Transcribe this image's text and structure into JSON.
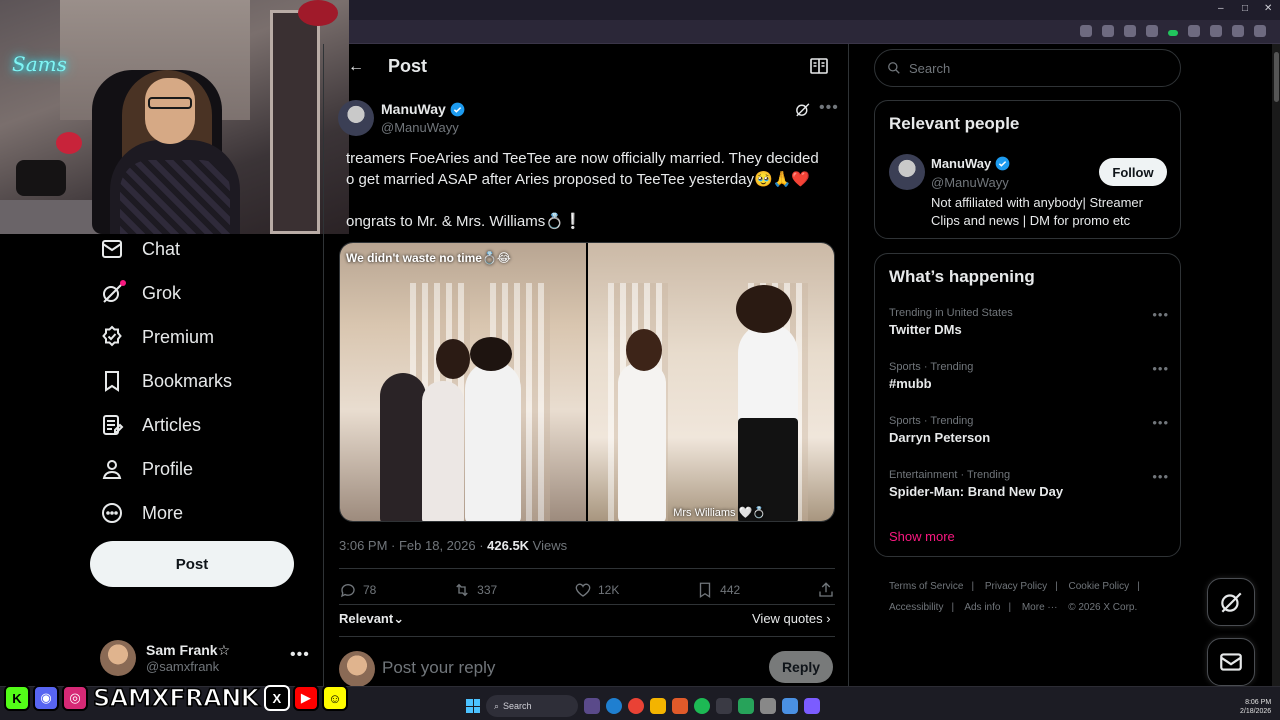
{
  "nav": {
    "chat": "Chat",
    "grok": "Grok",
    "premium": "Premium",
    "bookmarks": "Bookmarks",
    "articles": "Articles",
    "profile": "Profile",
    "more": "More",
    "post_button": "Post"
  },
  "current_user": {
    "name": "Sam Frank☆",
    "handle": "@samxfrank"
  },
  "header": {
    "title": "Post",
    "back": "←"
  },
  "tweet": {
    "author_name": "ManuWay",
    "author_handle": "@ManuWayy",
    "line1": "treamers FoeAries and TeeTee are now officially married. They decided",
    "line2": "o get married ASAP after Aries proposed to TeeTee yesterday🥹🙏❤️",
    "line3": "ongrats to Mr. & Mrs. Williams💍❕",
    "media_caption_left": "We didn't waste no time💍😂",
    "media_caption_right": "Mrs Williams 🤍💍",
    "time": "3:06 PM · Feb 18, 2026 · ",
    "views_count": "426.5K",
    "views_label": " Views",
    "replies": "78",
    "reposts": "337",
    "likes": "12K",
    "bookmarks": "442",
    "sort_label": "Relevant⌄",
    "view_quotes": "View quotes ›"
  },
  "reply": {
    "placeholder": "Post your reply",
    "button": "Reply"
  },
  "search": {
    "placeholder": "Search"
  },
  "relevant_people": {
    "title": "Relevant people",
    "name": "ManuWay",
    "handle": "@ManuWayy",
    "follow": "Follow",
    "bio": "Not affiliated with anybody| Streamer Clips and news | DM for promo etc"
  },
  "happening": {
    "title": "What’s happening",
    "trends": [
      {
        "meta": "Trending in United States",
        "title": "Twitter DMs"
      },
      {
        "meta": "Sports · Trending",
        "title": "#mubb"
      },
      {
        "meta": "Sports · Trending",
        "title": "Darryn Peterson"
      },
      {
        "meta": "Entertainment · Trending",
        "title": "Spider-Man: Brand New Day"
      }
    ],
    "show_more": "Show more"
  },
  "footer": {
    "terms": "Terms of Service",
    "privacy": "Privacy Policy",
    "cookie": "Cookie Policy",
    "accessibility": "Accessibility",
    "ads": "Ads info",
    "more": "More ···",
    "copyright": "© 2026 X Corp."
  },
  "stream": {
    "brand": "SAMXFRANK",
    "neon_sign": "Sams"
  },
  "taskbar": {
    "search": "Search",
    "time": "8:06 PM",
    "date": "2/18/2026"
  },
  "colors": {
    "accent_pink": "#f91880",
    "verified_blue": "#1d9bf0",
    "bg": "#000000"
  }
}
